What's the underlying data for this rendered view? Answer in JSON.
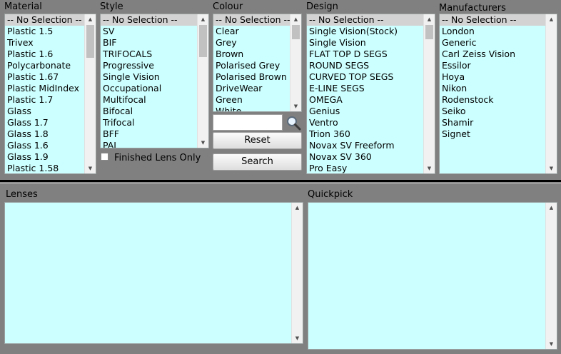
{
  "material": {
    "label": "Material",
    "items": [
      "-- No Selection --",
      "Plastic 1.5",
      "Trivex",
      "Plastic 1.6",
      "Polycarbonate",
      "Plastic 1.67",
      "Plastic MidIndex",
      "Plastic 1.7",
      "Glass",
      "Glass 1.7",
      "Glass 1.8",
      "Glass 1.6",
      "Glass 1.9",
      "Plastic 1.58"
    ]
  },
  "style": {
    "label": "Style",
    "items": [
      "-- No Selection --",
      "SV",
      "BIF",
      "TRIFOCALS",
      "Progressive",
      "Single Vision",
      "Occupational",
      "Multifocal",
      "Bifocal",
      "Trifocal",
      "BFF",
      "PAI"
    ],
    "finished_only_label": "Finished Lens Only"
  },
  "colour": {
    "label": "Colour",
    "items": [
      "-- No Selection --",
      "Clear",
      "Grey",
      "Brown",
      "Polarised Grey",
      "Polarised Brown",
      "DriveWear",
      "Green",
      "White"
    ],
    "search_value": "",
    "reset_label": "Reset",
    "search_label": "Search"
  },
  "design": {
    "label": "Design",
    "items": [
      "-- No Selection --",
      "Single Vision(Stock)",
      "Single Vision",
      "FLAT TOP D SEGS",
      "ROUND SEGS",
      "CURVED TOP SEGS",
      "E-LINE SEGS",
      "OMEGA",
      "Genius",
      "Ventro",
      "Trion 360",
      "Novax SV Freeform",
      "Novax SV 360",
      "Pro Easy"
    ]
  },
  "manufacturers": {
    "label": "Manufacturers",
    "items": [
      "-- No Selection --",
      "London",
      "Generic",
      "Carl Zeiss Vision",
      "Essilor",
      "Hoya",
      "Nikon",
      "Rodenstock",
      "Seiko",
      "Shamir",
      "Signet"
    ]
  },
  "lenses": {
    "label": "Lenses"
  },
  "quickpick": {
    "label": "Quickpick"
  },
  "icons": {
    "search": "magnifier-icon",
    "up": "▲",
    "down": "▼"
  }
}
